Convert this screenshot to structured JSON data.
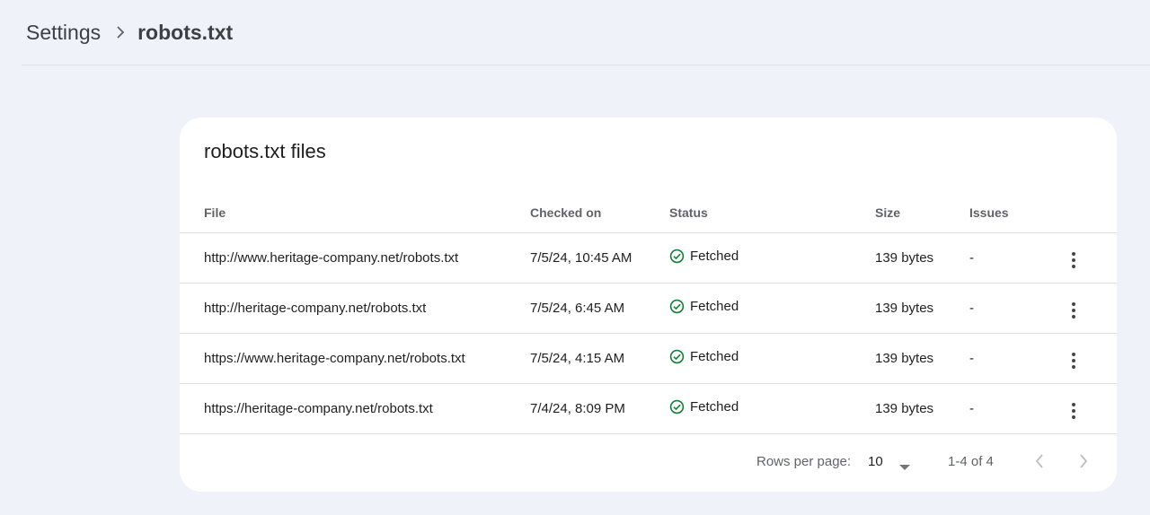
{
  "breadcrumb": {
    "root": "Settings",
    "current": "robots.txt"
  },
  "card": {
    "title": "robots.txt files"
  },
  "table": {
    "headers": {
      "file": "File",
      "checked_on": "Checked on",
      "status": "Status",
      "size": "Size",
      "issues": "Issues"
    },
    "rows": [
      {
        "file": "http://www.heritage-company.net/robots.txt",
        "checked_on": "7/5/24, 10:45 AM",
        "status": "Fetched",
        "size": "139 bytes",
        "issues": "-"
      },
      {
        "file": "http://heritage-company.net/robots.txt",
        "checked_on": "7/5/24, 6:45 AM",
        "status": "Fetched",
        "size": "139 bytes",
        "issues": "-"
      },
      {
        "file": "https://www.heritage-company.net/robots.txt",
        "checked_on": "7/5/24, 4:15 AM",
        "status": "Fetched",
        "size": "139 bytes",
        "issues": "-"
      },
      {
        "file": "https://heritage-company.net/robots.txt",
        "checked_on": "7/4/24, 8:09 PM",
        "status": "Fetched",
        "size": "139 bytes",
        "issues": "-"
      }
    ]
  },
  "pagination": {
    "rows_per_page_label": "Rows per page:",
    "rows_per_page_value": "10",
    "range": "1-4 of 4"
  },
  "colors": {
    "background": "#eff3f9",
    "card": "#ffffff",
    "status_ok": "#188038"
  },
  "icons": {
    "breadcrumb_separator": "chevron-right-icon",
    "status": "check-circle-icon",
    "row_menu": "more-vert-icon",
    "dropdown": "caret-down-icon",
    "prev": "chevron-left-icon",
    "next": "chevron-right-icon"
  }
}
